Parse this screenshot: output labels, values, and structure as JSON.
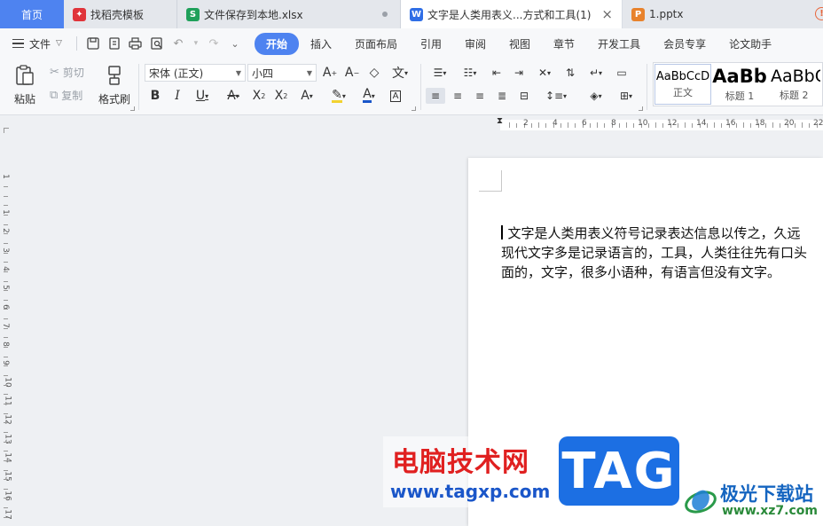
{
  "tabs": [
    {
      "label": "首页",
      "icon": "home"
    },
    {
      "label": "找稻壳模板",
      "icon": "daoke-icon",
      "icon_glyph": "✦",
      "icon_color": "#e0343a"
    },
    {
      "label": "文件保存到本地.xlsx",
      "icon": "excel-icon",
      "icon_glyph": "S",
      "icon_color": "#1fa05a"
    },
    {
      "label": "文字是人类用表义...方式和工具(1)",
      "icon": "writer-icon",
      "icon_glyph": "W",
      "icon_color": "#2f6ee6"
    },
    {
      "label": "1.pptx",
      "icon": "ppt-icon",
      "icon_glyph": "P",
      "icon_color": "#e8822c"
    }
  ],
  "menubar": {
    "file_label": "文件",
    "tabs": [
      "开始",
      "插入",
      "页面布局",
      "引用",
      "审阅",
      "视图",
      "章节",
      "开发工具",
      "会员专享",
      "论文助手"
    ],
    "active_tab": "开始"
  },
  "ribbon": {
    "paste_label": "粘贴",
    "cut_label": "剪切",
    "copy_label": "复制",
    "format_painter_label": "格式刷",
    "font_name": "宋体 (正文)",
    "font_size": "小四",
    "styles": [
      {
        "preview": "AaBbCcD",
        "label": "正文"
      },
      {
        "preview": "AaBb",
        "label": "标题 1"
      },
      {
        "preview": "AaBbC",
        "label": "标题 2"
      }
    ]
  },
  "ruler": {
    "h_numbers": [
      "2",
      "4",
      "6",
      "8",
      "10",
      "12",
      "14",
      "16",
      "18",
      "20",
      "22"
    ],
    "v_numbers": [
      "1",
      "1",
      "2",
      "3",
      "4",
      "5",
      "6",
      "7",
      "8",
      "9",
      "10",
      "11",
      "12",
      "13",
      "14",
      "15",
      "16",
      "17"
    ]
  },
  "document": {
    "lines": [
      "文字是人类用表义符号记录表达信息以传之，久远",
      "现代文字多是记录语言的，工具，人类往往先有口头",
      "面的，文字，很多小语种，有语言但没有文字。"
    ]
  },
  "watermarks": {
    "site_cn": "电脑技术网",
    "site_url": "www.tagxp.com",
    "tag": "TAG",
    "brand_cn": "极光下载站",
    "brand_url": "www.xz7.com"
  },
  "colors": {
    "accent": "#4e83f0",
    "tab_bar": "#dfe3ea",
    "page_bg": "#eef0f3"
  }
}
